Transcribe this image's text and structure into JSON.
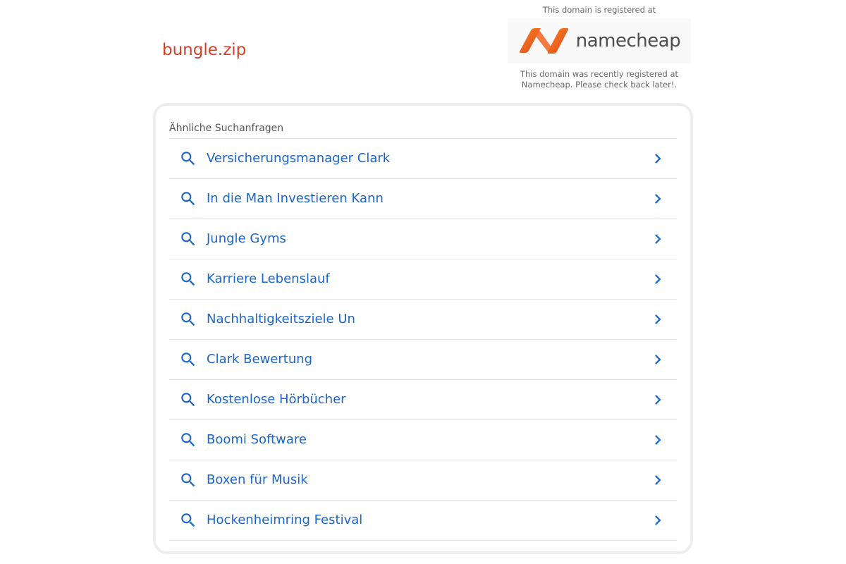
{
  "header": {
    "domain_name": "bungle.zip",
    "registrar_top_text": "This domain is registered at",
    "registrar_logo_text": "namecheap",
    "registrar_bottom_text": "This domain was recently registered at Namecheap. Please check back later!."
  },
  "related": {
    "title": "Ähnliche Suchanfragen",
    "items": [
      {
        "label": "Versicherungsmanager Clark"
      },
      {
        "label": "In die Man Investieren Kann"
      },
      {
        "label": "Jungle Gyms"
      },
      {
        "label": "Karriere Lebenslauf"
      },
      {
        "label": "Nachhaltigkeitsziele Un"
      },
      {
        "label": "Clark Bewertung"
      },
      {
        "label": "Kostenlose Hörbücher"
      },
      {
        "label": "Boomi Software"
      },
      {
        "label": "Boxen für Musik"
      },
      {
        "label": "Hockenheimring Festival"
      }
    ]
  },
  "colors": {
    "domain": "#d6402c",
    "link": "#1a66cc",
    "logo_orange": "#f26522",
    "divider": "#e3e3e3"
  },
  "icons": {
    "row_icon": "search-icon",
    "row_arrow": "chevron-right-icon"
  }
}
